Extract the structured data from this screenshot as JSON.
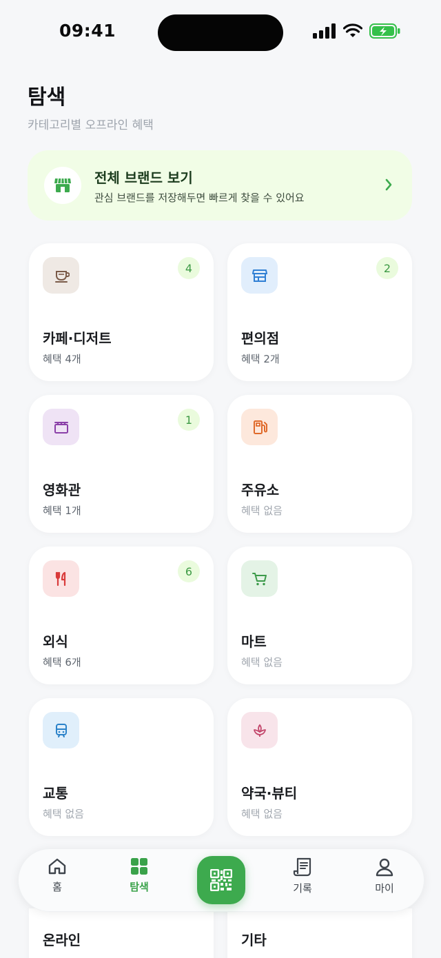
{
  "status_bar": {
    "time": "09:41"
  },
  "header": {
    "title": "탐색",
    "subtitle": "카테고리별 오프라인 혜택"
  },
  "brand_banner": {
    "title": "전체 브랜드 보기",
    "description": "관심 브랜드를 저장해두면 빠르게 찾을 수 있어요"
  },
  "categories": [
    {
      "name": "카페·디저트",
      "desc": "혜택 4개",
      "count": "4",
      "icon": "coffee-cup-icon",
      "bg": "#efe9e4",
      "fg": "#7a5a48"
    },
    {
      "name": "편의점",
      "desc": "혜택 2개",
      "count": "2",
      "icon": "store-icon",
      "bg": "#e1eefc",
      "fg": "#2f7fd4"
    },
    {
      "name": "영화관",
      "desc": "혜택 1개",
      "count": "1",
      "icon": "clapperboard-icon",
      "bg": "#efe3f5",
      "fg": "#8a3fa8"
    },
    {
      "name": "주유소",
      "desc": "혜택 없음",
      "count": "",
      "icon": "fuel-pump-icon",
      "bg": "#fde8dc",
      "fg": "#e06a2a"
    },
    {
      "name": "외식",
      "desc": "혜택 6개",
      "count": "6",
      "icon": "fork-knife-icon",
      "bg": "#fbe3e3",
      "fg": "#d93a3a"
    },
    {
      "name": "마트",
      "desc": "혜택 없음",
      "count": "",
      "icon": "shopping-cart-icon",
      "bg": "#e4f3e6",
      "fg": "#3c9a4a"
    },
    {
      "name": "교통",
      "desc": "혜택 없음",
      "count": "",
      "icon": "train-icon",
      "bg": "#e0effb",
      "fg": "#2b82c9"
    },
    {
      "name": "약국·뷰티",
      "desc": "혜택 없음",
      "count": "",
      "icon": "lotus-icon",
      "bg": "#f8e4ea",
      "fg": "#c2456a"
    },
    {
      "name": "온라인"
    },
    {
      "name": "기타"
    }
  ],
  "nav": {
    "home": "홈",
    "explore": "탐색",
    "history": "기록",
    "my": "마이"
  },
  "colors": {
    "accent": "#3daa4e",
    "banner_bg": "#f1fde6",
    "badge_bg": "#eafbdd"
  }
}
